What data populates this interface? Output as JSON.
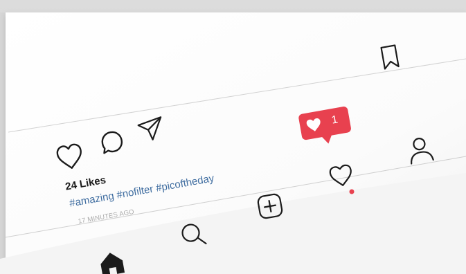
{
  "post": {
    "likes_text": "24 Likes",
    "hashtags_text": "#amazing #nofilter #picoftheday",
    "time_text": "17 MINUTES AGO"
  },
  "notification": {
    "count": "1"
  },
  "icons": {
    "like": "heart-icon",
    "comment": "comment-bubble-icon",
    "share": "paper-plane-icon",
    "save": "bookmark-icon",
    "home": "home-icon",
    "search": "search-icon",
    "new_post": "plus-square-icon",
    "activity": "heart-icon",
    "profile": "user-icon"
  },
  "colors": {
    "notification": "#e8414f",
    "hashtag": "#3f6da0",
    "activity_dot": "#e8414f"
  }
}
